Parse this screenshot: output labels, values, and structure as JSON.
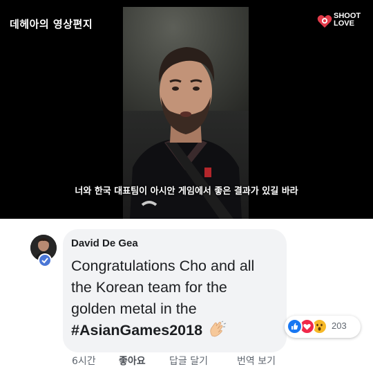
{
  "video": {
    "title_overlay": "데헤아의 영상편지",
    "logo_line1": "SHOOT",
    "logo_line2": "LOVE",
    "subtitle": "너와 한국 대표팀이 아시안 게임에서 좋은 결과가 있길 바라"
  },
  "comment": {
    "author": "David De Gea",
    "text_line1": "Congratulations Cho and all",
    "text_line2": "the Korean team for the",
    "text_line3": "golden metal in the",
    "hashtag": "#AsianGames2018",
    "reaction_count": "203",
    "time": "6시간",
    "like_label": "좋아요",
    "reply_label": "답글 달기",
    "translate_label": "번역 보기"
  },
  "colors": {
    "like_blue": "#1877f2",
    "love_red": "#f02849",
    "wow_yellow": "#f7b928",
    "verified_blue": "#4a76d6",
    "bubble_bg": "#f2f3f5"
  },
  "icons": [
    "heart-logo-icon",
    "verified-badge-icon",
    "clapping-hands-icon",
    "like-reaction-icon",
    "love-reaction-icon",
    "wow-reaction-icon"
  ]
}
